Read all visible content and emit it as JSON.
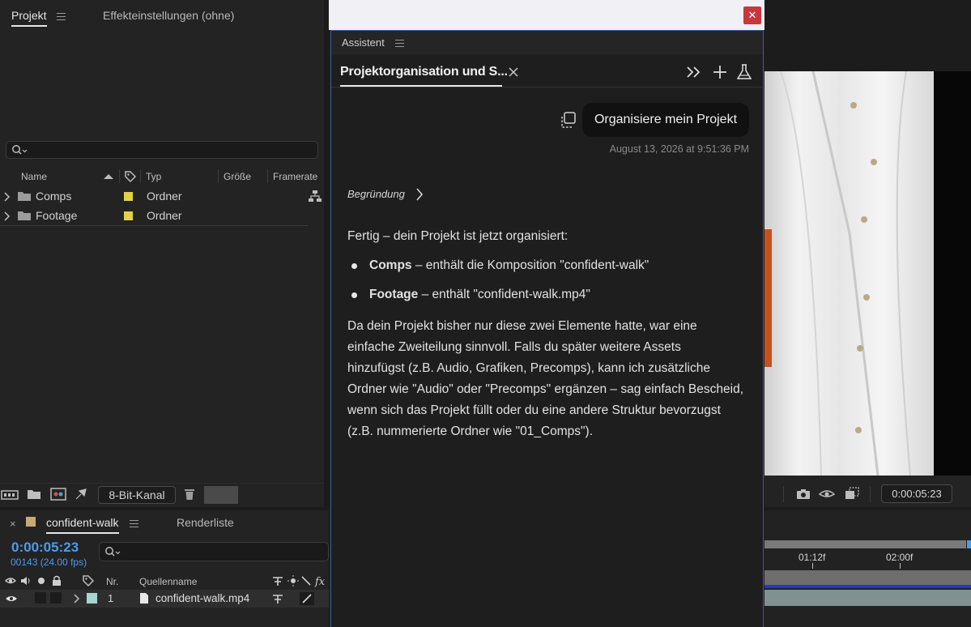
{
  "project_panel": {
    "tab_project": "Projekt",
    "tab_effects": "Effekteinstellungen (ohne)",
    "columns": [
      "Name",
      "Typ",
      "Größe",
      "Framerate"
    ],
    "rows": [
      {
        "name": "Comps",
        "type": "Ordner"
      },
      {
        "name": "Footage",
        "type": "Ordner"
      }
    ],
    "bit_depth": "8-Bit-Kanal"
  },
  "viewer": {
    "timecode": "0:00:05:23"
  },
  "timeline": {
    "tab_comp": "confident-walk",
    "tab_render": "Renderliste",
    "current_time": "0:00:05:23",
    "frames": "00143 (24.00 fps)",
    "col_nr": "Nr.",
    "col_source": "Quellenname",
    "ruler": [
      "01:12f",
      "02:00f"
    ],
    "layer": {
      "number": "1",
      "name": "confident-walk.mp4"
    }
  },
  "assistant": {
    "panel_title": "Assistent",
    "chat_tab": "Projektorganisation und S...",
    "user_message": "Organisiere mein Projekt",
    "timestamp": "August 13, 2026 at 9:51:36 PM",
    "reasoning_label": "Begründung",
    "reply_intro": "Fertig – dein Projekt ist jetzt organisiert:",
    "bullets": [
      {
        "bold": "Comps",
        "text": " – enthält die Komposition \"confident-walk\""
      },
      {
        "bold": "Footage",
        "text": " – enthält \"confident-walk.mp4\""
      }
    ],
    "reply_body_lines": [
      "Da dein Projekt bisher nur diese zwei Elemente hatte, war eine",
      "einfache Zweiteilung sinnvoll. Falls du später weitere Assets",
      "hinzufügst (z.B. Audio, Grafiken, Precomps), kann ich zusätzliche",
      "Ordner wie \"Audio\" oder \"Precomps\" ergänzen – sag einfach Bescheid,",
      "wenn sich das Projekt füllt oder du eine andere Struktur bevorzugst",
      "(z.B. nummerierte Ordner wie \"01_Comps\")."
    ]
  },
  "colors": {
    "accent_blue": "#4a9bf1",
    "folder_label": "#e3d04a",
    "close_red": "#c9363c"
  }
}
